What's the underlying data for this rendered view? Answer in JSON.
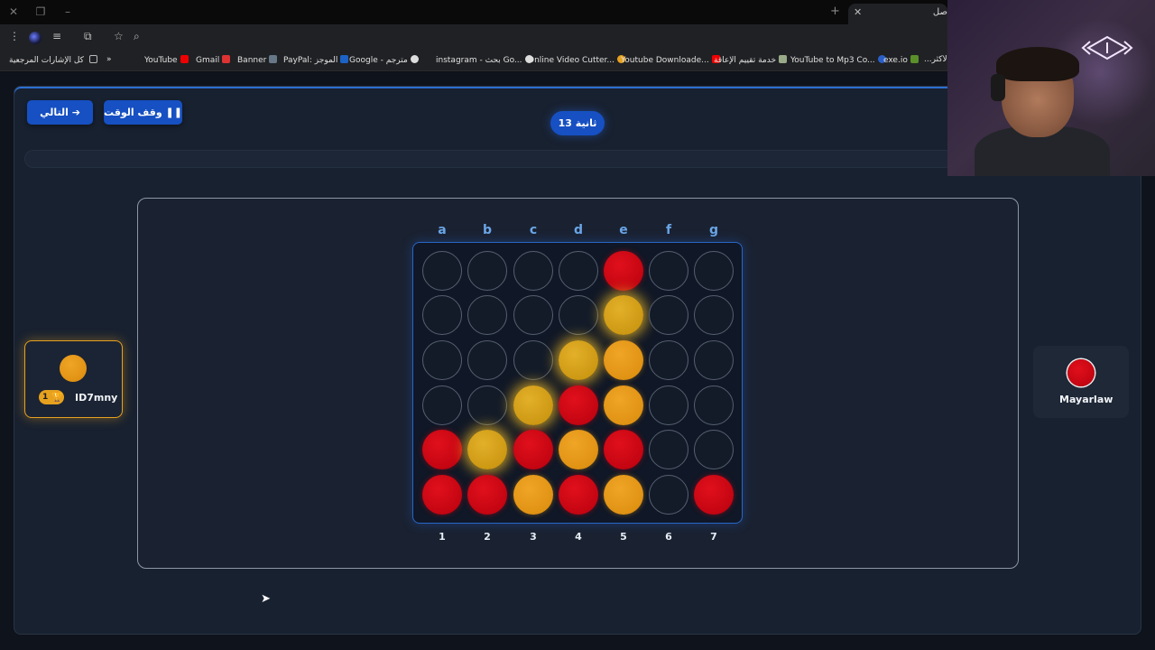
{
  "browser": {
    "tab_title": "صل",
    "bookmarks": [
      "كل الإشارات المرجعية",
      "YouTube",
      "Gmail",
      "Banner",
      "PayPal: الموجز",
      "Google - مترجم",
      "instagram - بحث Go...",
      "Online Video Cutter...",
      "Youtube Downloade...",
      "خدمة تقييم الإعاقة",
      "YouTube to Mp3 Co...",
      "exe.io",
      "...الاكثر"
    ],
    "more_chevron": "»"
  },
  "controls": {
    "next_label": "التالي",
    "pause_label": "وقف الوقت",
    "timer_label": "13 ثانية"
  },
  "board": {
    "columns": [
      "a",
      "b",
      "c",
      "d",
      "e",
      "f",
      "g"
    ],
    "numbers": [
      "1",
      "2",
      "3",
      "4",
      "5",
      "6",
      "7"
    ],
    "rows": [
      [
        "empty",
        "empty",
        "empty",
        "empty",
        "red",
        "empty",
        "empty"
      ],
      [
        "empty",
        "empty",
        "empty",
        "empty",
        "win",
        "empty",
        "empty"
      ],
      [
        "empty",
        "empty",
        "empty",
        "win",
        "yellow",
        "empty",
        "empty"
      ],
      [
        "empty",
        "empty",
        "win",
        "red",
        "yellow",
        "empty",
        "empty"
      ],
      [
        "red",
        "win",
        "red",
        "yellow",
        "red",
        "empty",
        "empty"
      ],
      [
        "red",
        "red",
        "yellow",
        "red",
        "yellow",
        "empty",
        "red"
      ]
    ]
  },
  "players": {
    "left": {
      "name": "ID7mny",
      "color": "#e69a1a",
      "score": "1",
      "active": true
    },
    "right": {
      "name": "Mayarlaw",
      "color": "#d0101c",
      "active": false
    }
  },
  "colors": {
    "accent": "#1650c2",
    "red_disc": "#d0101c",
    "yellow_disc": "#e69a1a",
    "board_border": "#2866c6"
  }
}
